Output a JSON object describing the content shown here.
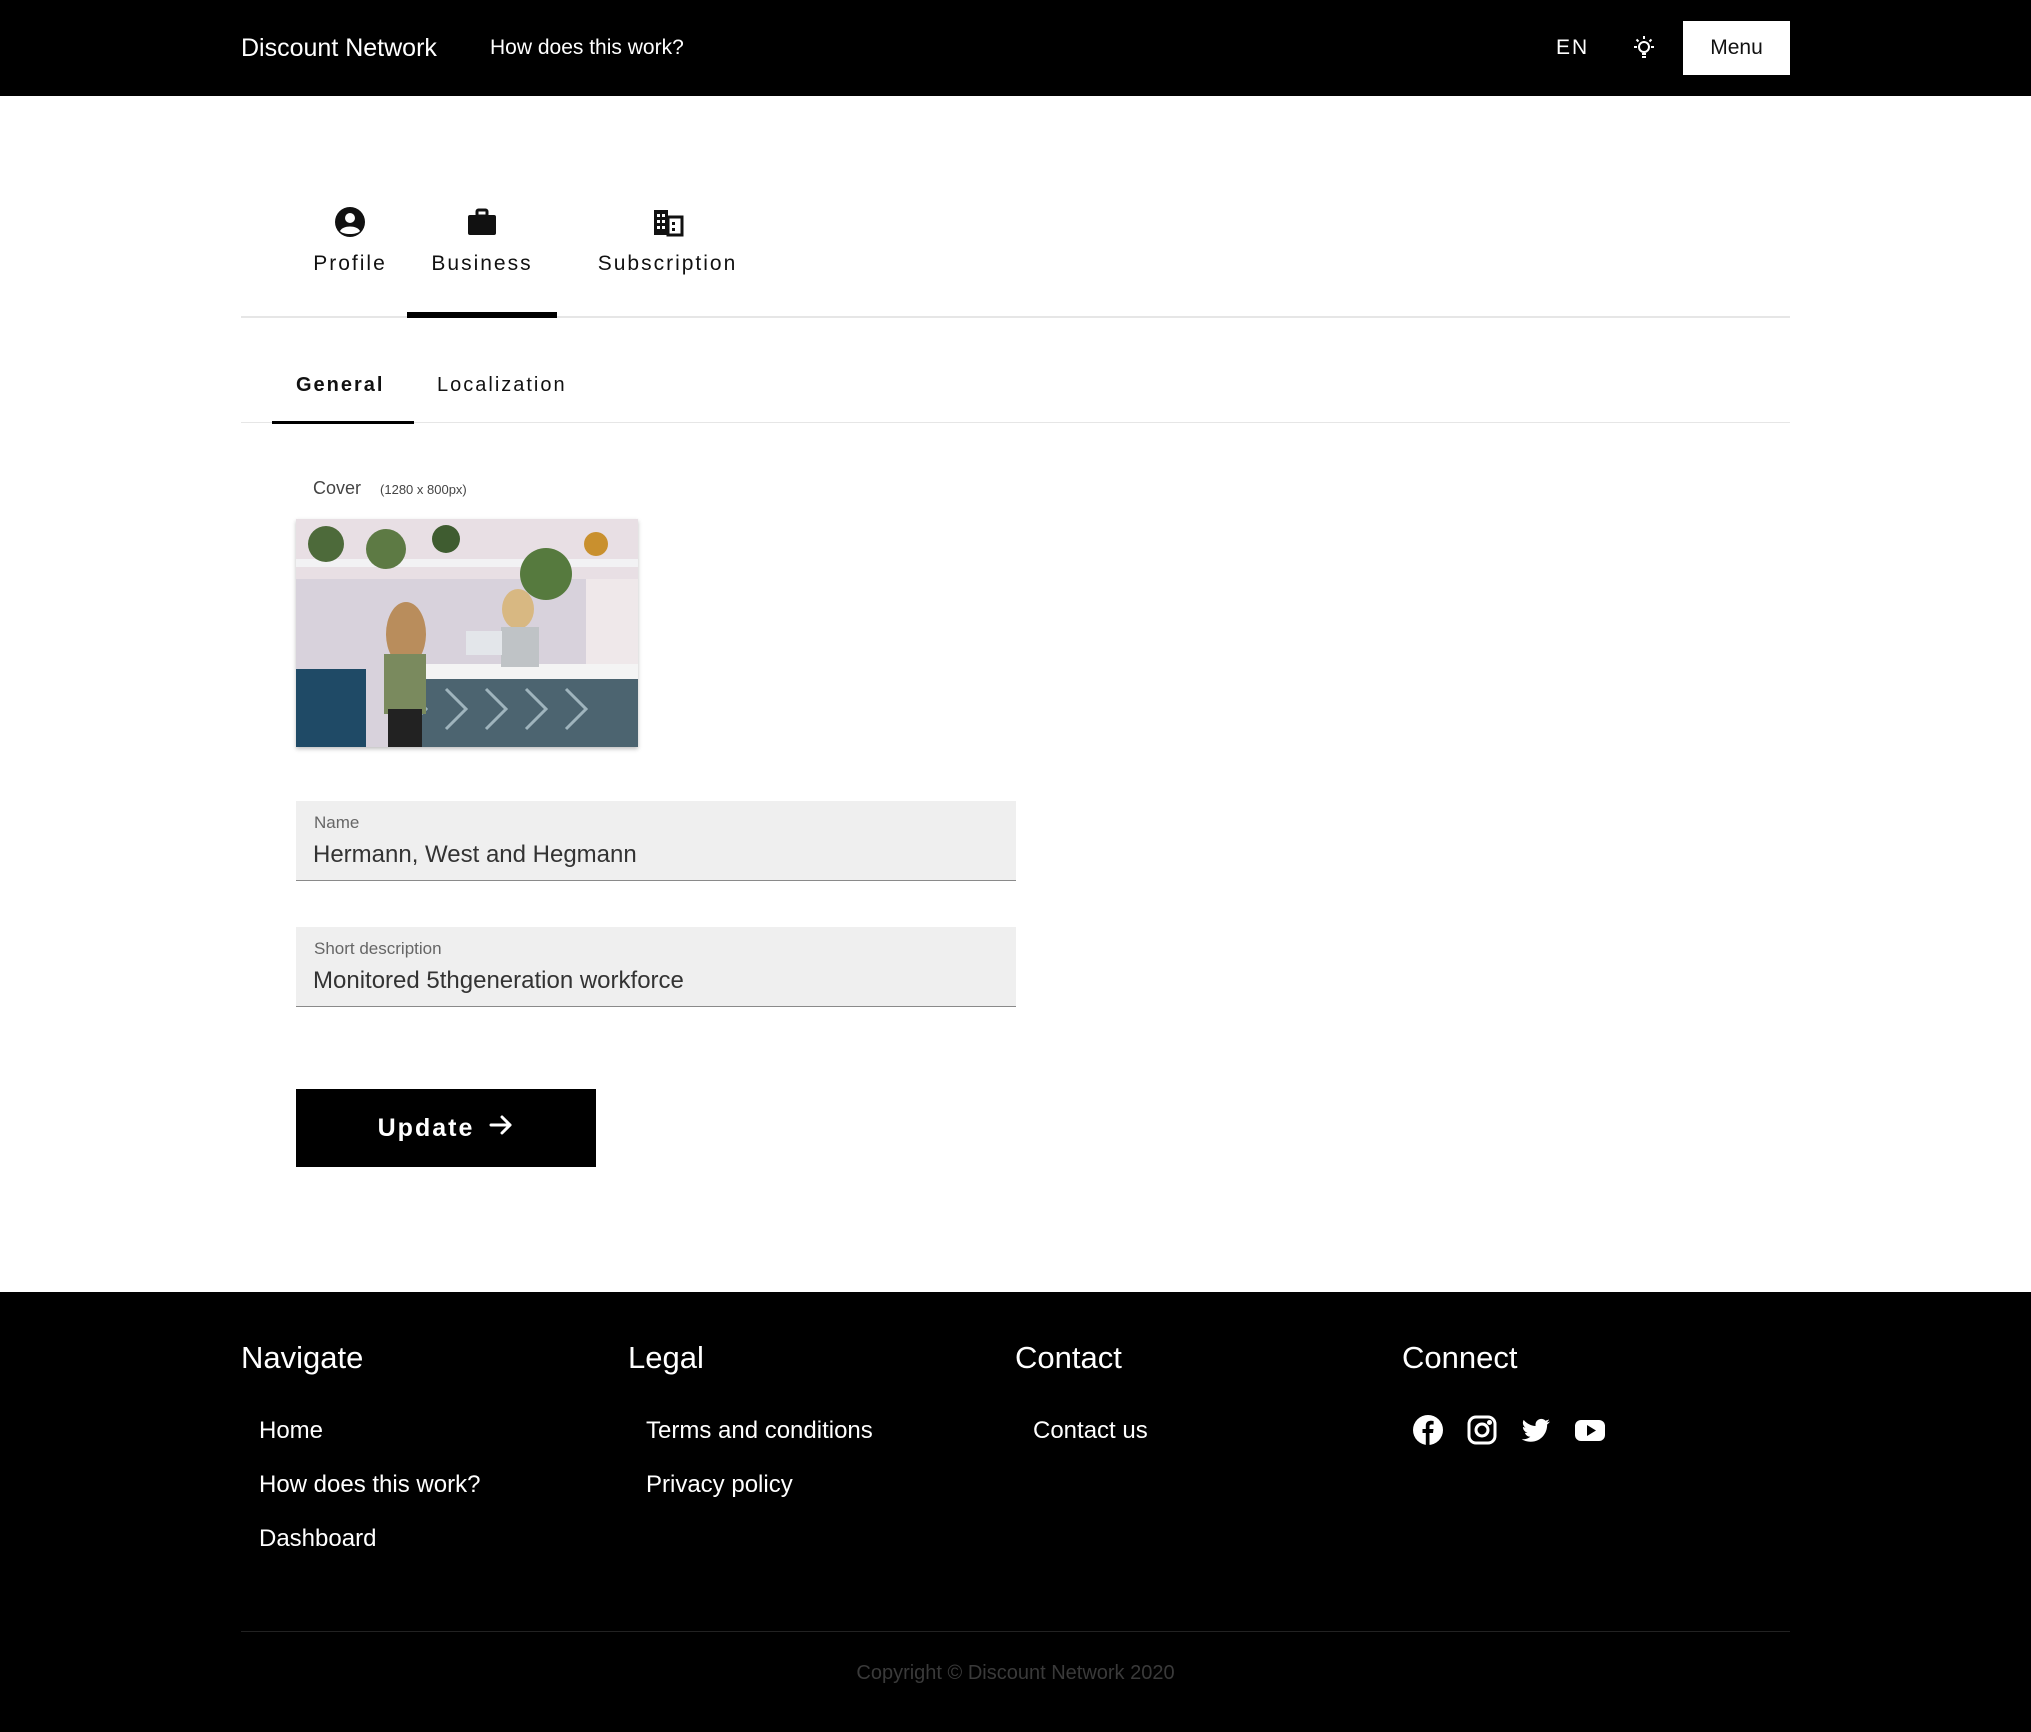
{
  "header": {
    "brand": "Discount Network",
    "how_link": "How does this work?",
    "language": "EN",
    "menu_label": "Menu"
  },
  "main_tabs": [
    {
      "label": "Profile",
      "icon": "account-circle-icon",
      "active": false
    },
    {
      "label": "Business",
      "icon": "briefcase-icon",
      "active": true
    },
    {
      "label": "Subscription",
      "icon": "building-icon",
      "active": false
    }
  ],
  "sub_tabs": [
    {
      "label": "General",
      "active": true
    },
    {
      "label": "Localization",
      "active": false
    }
  ],
  "form": {
    "cover_label": "Cover",
    "cover_hint": "(1280 x 800px)",
    "name_label": "Name",
    "name_value": "Hermann, West and Hegmann",
    "description_label": "Short description",
    "description_value": "Monitored 5thgeneration workforce",
    "update_label": "Update"
  },
  "footer": {
    "navigate": {
      "title": "Navigate",
      "links": [
        "Home",
        "How does this work?",
        "Dashboard"
      ]
    },
    "legal": {
      "title": "Legal",
      "links": [
        "Terms and conditions",
        "Privacy policy"
      ]
    },
    "contact": {
      "title": "Contact",
      "links": [
        "Contact us"
      ]
    },
    "connect": {
      "title": "Connect",
      "icons": [
        "facebook-icon",
        "instagram-icon",
        "twitter-icon",
        "youtube-icon"
      ]
    },
    "copyright": "Copyright © Discount Network 2020"
  },
  "colors": {
    "header_bg": "#000000",
    "footer_bg": "#000000",
    "field_bg": "#efefef",
    "accent": "#000000"
  }
}
